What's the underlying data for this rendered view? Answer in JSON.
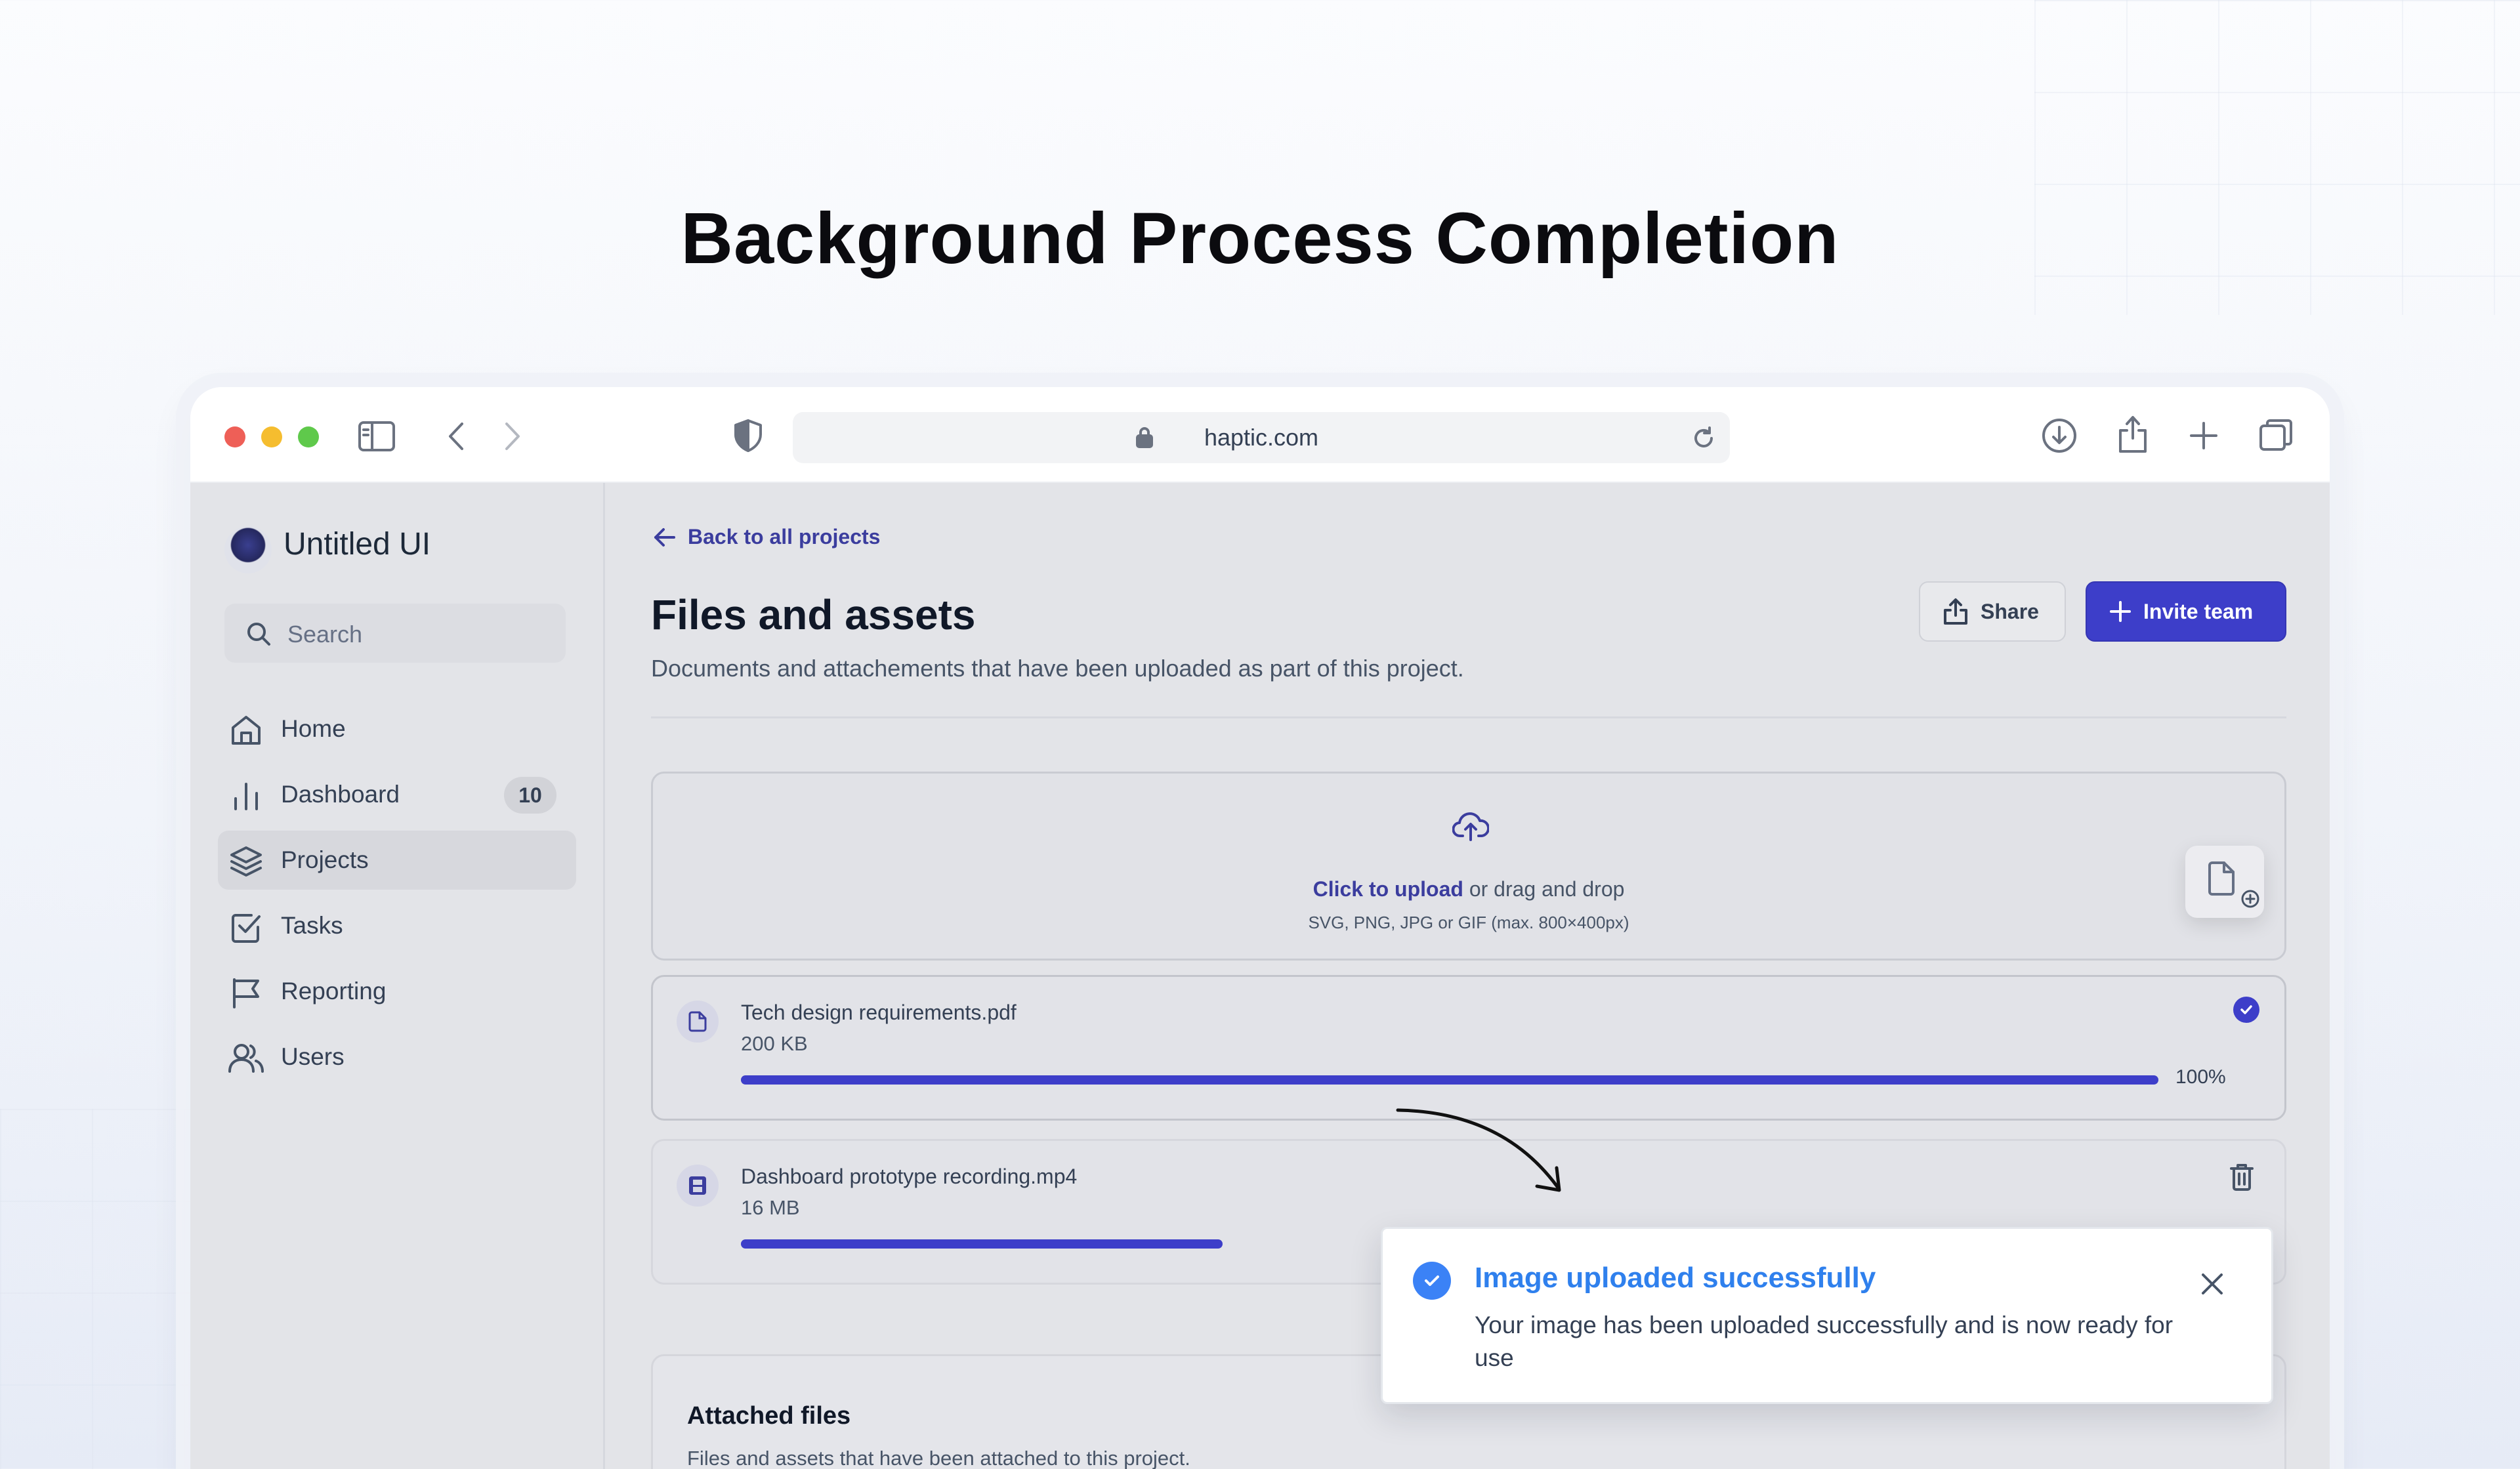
{
  "headline": "Background Process Completion",
  "browser": {
    "url": "haptic.com",
    "traffic_lights": {
      "close": "#ee5f57",
      "minimize": "#f5bd2f",
      "maximize": "#5fc94b"
    }
  },
  "sidebar": {
    "brand": "Untitled UI",
    "search_placeholder": "Search",
    "items": [
      {
        "label": "Home",
        "icon": "home-icon"
      },
      {
        "label": "Dashboard",
        "icon": "bar-chart-icon",
        "badge": "10"
      },
      {
        "label": "Projects",
        "icon": "layers-icon",
        "active": true
      },
      {
        "label": "Tasks",
        "icon": "check-square-icon"
      },
      {
        "label": "Reporting",
        "icon": "flag-icon"
      },
      {
        "label": "Users",
        "icon": "users-icon"
      }
    ]
  },
  "main": {
    "back_link": "Back to all projects",
    "title": "Files and assets",
    "subtitle": "Documents and attachements that have been uploaded as part of this project.",
    "share_label": "Share",
    "invite_label": "Invite team",
    "upload": {
      "click_text": "Click to upload",
      "drag_text": " or drag and drop",
      "hint": "SVG, PNG, JPG or GIF (max. 800×400px)"
    },
    "files": [
      {
        "name": "Tech design requirements.pdf",
        "size": "200 KB",
        "progress": 1.0,
        "progress_label": "100%",
        "status": "complete"
      },
      {
        "name": "Dashboard prototype recording.mp4",
        "size": "16 MB",
        "progress": 0.34,
        "status": "uploading"
      }
    ],
    "attached": {
      "title": "Attached files",
      "subtitle": "Files and assets that have been attached to this project."
    }
  },
  "toast": {
    "title": "Image uploaded successfully",
    "body": "Your image has been uploaded successfully and is now ready for use"
  },
  "colors": {
    "accent": "#3d3ec9",
    "toast_title": "#2f80ed",
    "check": "#3b82f6"
  }
}
